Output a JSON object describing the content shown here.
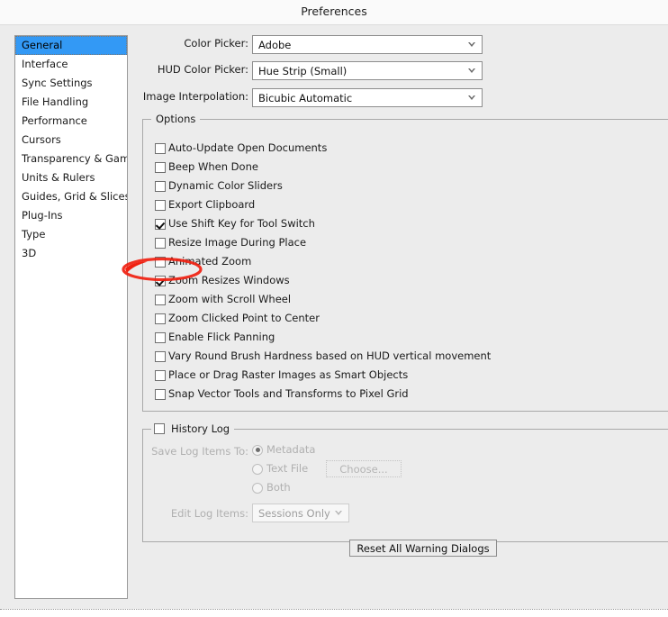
{
  "window": {
    "title": "Preferences"
  },
  "sidebar": {
    "items": [
      {
        "label": "General",
        "selected": true
      },
      {
        "label": "Interface",
        "selected": false
      },
      {
        "label": "Sync Settings",
        "selected": false
      },
      {
        "label": "File Handling",
        "selected": false
      },
      {
        "label": "Performance",
        "selected": false
      },
      {
        "label": "Cursors",
        "selected": false
      },
      {
        "label": "Transparency & Gamut",
        "selected": false
      },
      {
        "label": "Units & Rulers",
        "selected": false
      },
      {
        "label": "Guides, Grid & Slices",
        "selected": false
      },
      {
        "label": "Plug-Ins",
        "selected": false
      },
      {
        "label": "Type",
        "selected": false
      },
      {
        "label": "3D",
        "selected": false
      }
    ]
  },
  "fields": [
    {
      "label": "Color Picker:",
      "value": "Adobe"
    },
    {
      "label": "HUD Color Picker:",
      "value": "Hue Strip (Small)"
    },
    {
      "label": "Image Interpolation:",
      "value": "Bicubic Automatic"
    }
  ],
  "options": {
    "title": "Options",
    "items": [
      {
        "label": "Auto-Update Open Documents",
        "checked": false
      },
      {
        "label": "Beep When Done",
        "checked": false
      },
      {
        "label": "Dynamic Color Sliders",
        "checked": false
      },
      {
        "label": "Export Clipboard",
        "checked": false
      },
      {
        "label": "Use Shift Key for Tool Switch",
        "checked": true
      },
      {
        "label": "Resize Image During Place",
        "checked": false
      },
      {
        "label": "Animated Zoom",
        "checked": false
      },
      {
        "label": "Zoom Resizes Windows",
        "checked": true
      },
      {
        "label": "Zoom with Scroll Wheel",
        "checked": false
      },
      {
        "label": "Zoom Clicked Point to Center",
        "checked": false
      },
      {
        "label": "Enable Flick Panning",
        "checked": false
      },
      {
        "label": "Vary Round Brush Hardness based on HUD vertical movement",
        "checked": false
      },
      {
        "label": "Place or Drag Raster Images as Smart Objects",
        "checked": false
      },
      {
        "label": "Snap Vector Tools and Transforms to Pixel Grid",
        "checked": false
      }
    ]
  },
  "history_log": {
    "title": "History Log",
    "enabled": false,
    "save_log_label": "Save Log Items To:",
    "radios": [
      {
        "label": "Metadata",
        "selected": true
      },
      {
        "label": "Text File",
        "selected": false
      },
      {
        "label": "Both",
        "selected": false
      }
    ],
    "choose_button": "Choose...",
    "edit_log_label": "Edit Log Items:",
    "edit_log_value": "Sessions Only"
  },
  "footer": {
    "reset_button": "Reset All Warning Dialogs"
  },
  "annotation": {
    "shape": "ellipse",
    "color": "#f02010",
    "targets": "Resize Image During Place"
  },
  "colors": {
    "selection_blue": "#3399f5",
    "dialog_bg": "#ececec",
    "annotation_red": "#f02010"
  }
}
